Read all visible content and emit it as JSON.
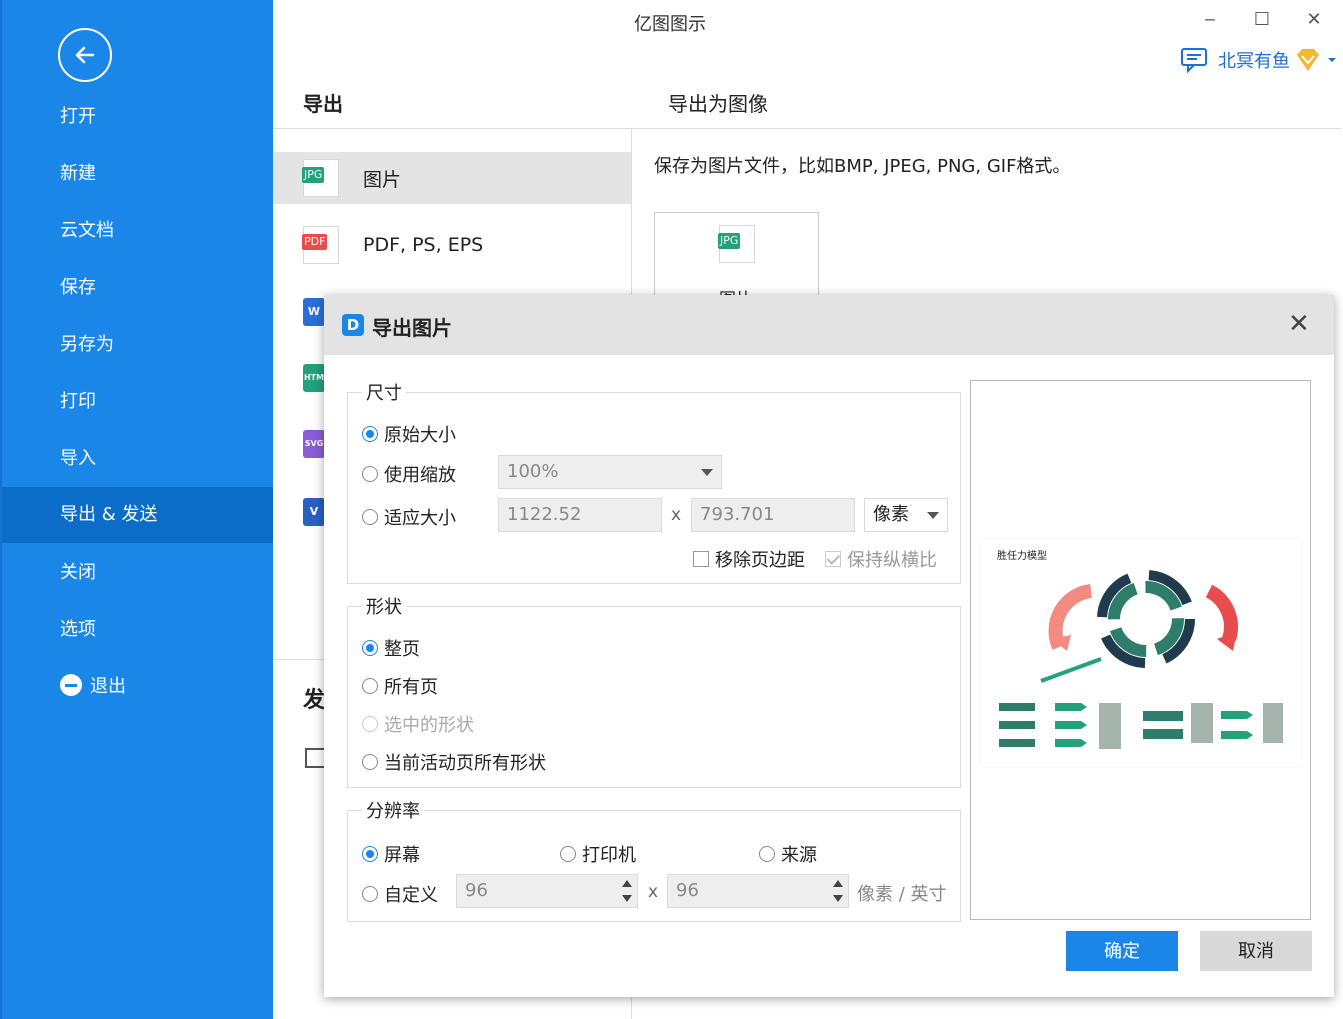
{
  "window": {
    "title": "亿图图示",
    "minimize_glyph": "‒",
    "maximize_glyph": "☐",
    "close_glyph": "✕"
  },
  "user": {
    "name": "北冥有鱼",
    "chat_icon": "chat-icon",
    "vip_icon": "vip-diamond-icon"
  },
  "sidebar": {
    "back_icon": "back-arrow-icon",
    "items": [
      {
        "label": "打开"
      },
      {
        "label": "新建"
      },
      {
        "label": "云文档"
      },
      {
        "label": "保存"
      },
      {
        "label": "另存为"
      },
      {
        "label": "打印"
      },
      {
        "label": "导入"
      },
      {
        "label": "导出 & 发送",
        "active": true
      },
      {
        "label": "关闭"
      },
      {
        "label": "选项"
      },
      {
        "label": "退出"
      }
    ]
  },
  "export_panel": {
    "title": "导出",
    "subtitle": "导出为图像",
    "formats": [
      {
        "badge": "JPG",
        "label": "图片",
        "active": true
      },
      {
        "badge": "PDF",
        "label": "PDF, PS, EPS"
      }
    ],
    "hidden_format_badges": [
      "W",
      "HTM",
      "SVG",
      "V"
    ],
    "description": "保存为图片文件，比如BMP, JPEG, PNG, GIF格式。",
    "card": {
      "badge": "JPG",
      "label": "图片"
    },
    "send_title": "发",
    "mail_icon": "mail-icon"
  },
  "dialog": {
    "logo_glyph": "D",
    "title": "导出图片",
    "close_glyph": "✕",
    "size_group": {
      "title": "尺寸",
      "original_label": "原始大小",
      "scale_label": "使用缩放",
      "scale_value": "100%",
      "fit_label": "适应大小",
      "width_value": "1122.52",
      "times": "x",
      "height_value": "793.701",
      "unit_value": "像素",
      "remove_margin_label": "移除页边距",
      "keep_ratio_label": "保持纵横比"
    },
    "shape_group": {
      "title": "形状",
      "options": [
        "整页",
        "所有页",
        "选中的形状",
        "当前活动页所有形状"
      ]
    },
    "resolution_group": {
      "title": "分辨率",
      "screen_label": "屏幕",
      "printer_label": "打印机",
      "source_label": "来源",
      "custom_label": "自定义",
      "dpi_x": "96",
      "times": "x",
      "dpi_y": "96",
      "unit": "像素 / 英寸"
    },
    "preview": {
      "title": "胜任力模型"
    },
    "ok_label": "确定",
    "cancel_label": "取消"
  },
  "colors": {
    "sidebar_bg": "#1a86e8",
    "sidebar_active": "#0c6dc9",
    "primary_button": "#1a86e8",
    "jpg_badge": "#22a17a",
    "pdf_badge": "#e84c4c"
  }
}
